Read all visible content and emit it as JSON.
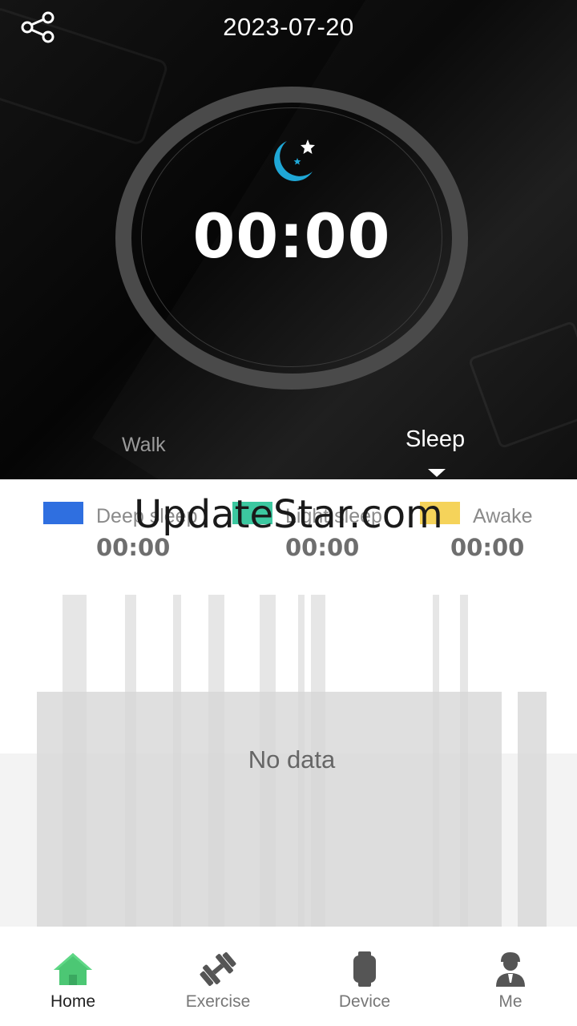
{
  "header": {
    "date": "2023-07-20"
  },
  "ring": {
    "time": "00:00"
  },
  "tabs": [
    {
      "label": "Walk"
    },
    {
      "label": "Sleep",
      "selected": true
    }
  ],
  "legend": [
    {
      "label": "Deep sleep",
      "value": "00:00",
      "color": "#2f6fe0"
    },
    {
      "label": "Light sleep",
      "value": "00:00",
      "color": "#3cc8a0"
    },
    {
      "label": "Awake",
      "value": "00:00",
      "color": "#f5d35a"
    }
  ],
  "watermark": "UpdateStar.com",
  "chart": {
    "empty_text": "No data"
  },
  "nav": [
    {
      "label": "Home",
      "icon": "home-icon",
      "active": true,
      "color": "#4cc774"
    },
    {
      "label": "Exercise",
      "icon": "dumbbell-icon"
    },
    {
      "label": "Device",
      "icon": "watch-icon"
    },
    {
      "label": "Me",
      "icon": "person-icon"
    }
  ],
  "colors": {
    "background_top": "#0a0a0a",
    "ring": "#4a4a4a",
    "accent": "#4cc774"
  }
}
